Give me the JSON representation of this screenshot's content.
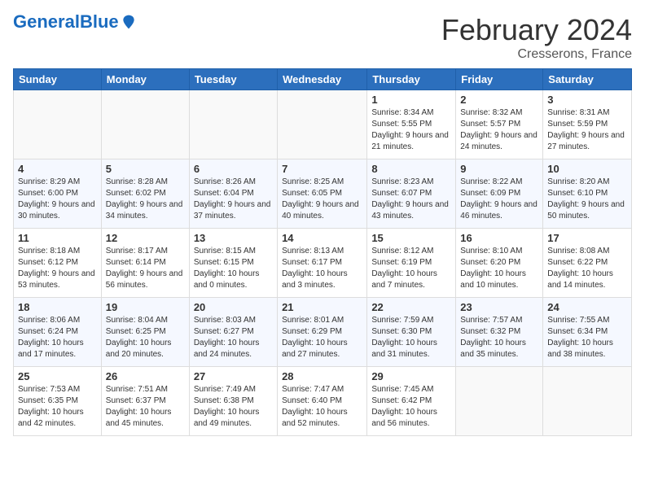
{
  "header": {
    "logo_general": "General",
    "logo_blue": "Blue",
    "month_title": "February 2024",
    "location": "Cresserons, France"
  },
  "days_of_week": [
    "Sunday",
    "Monday",
    "Tuesday",
    "Wednesday",
    "Thursday",
    "Friday",
    "Saturday"
  ],
  "weeks": [
    [
      {
        "day": "",
        "sunrise": "",
        "sunset": "",
        "daylight": ""
      },
      {
        "day": "",
        "sunrise": "",
        "sunset": "",
        "daylight": ""
      },
      {
        "day": "",
        "sunrise": "",
        "sunset": "",
        "daylight": ""
      },
      {
        "day": "",
        "sunrise": "",
        "sunset": "",
        "daylight": ""
      },
      {
        "day": "1",
        "sunrise": "8:34 AM",
        "sunset": "5:55 PM",
        "daylight": "9 hours and 21 minutes."
      },
      {
        "day": "2",
        "sunrise": "8:32 AM",
        "sunset": "5:57 PM",
        "daylight": "9 hours and 24 minutes."
      },
      {
        "day": "3",
        "sunrise": "8:31 AM",
        "sunset": "5:59 PM",
        "daylight": "9 hours and 27 minutes."
      }
    ],
    [
      {
        "day": "4",
        "sunrise": "8:29 AM",
        "sunset": "6:00 PM",
        "daylight": "9 hours and 30 minutes."
      },
      {
        "day": "5",
        "sunrise": "8:28 AM",
        "sunset": "6:02 PM",
        "daylight": "9 hours and 34 minutes."
      },
      {
        "day": "6",
        "sunrise": "8:26 AM",
        "sunset": "6:04 PM",
        "daylight": "9 hours and 37 minutes."
      },
      {
        "day": "7",
        "sunrise": "8:25 AM",
        "sunset": "6:05 PM",
        "daylight": "9 hours and 40 minutes."
      },
      {
        "day": "8",
        "sunrise": "8:23 AM",
        "sunset": "6:07 PM",
        "daylight": "9 hours and 43 minutes."
      },
      {
        "day": "9",
        "sunrise": "8:22 AM",
        "sunset": "6:09 PM",
        "daylight": "9 hours and 46 minutes."
      },
      {
        "day": "10",
        "sunrise": "8:20 AM",
        "sunset": "6:10 PM",
        "daylight": "9 hours and 50 minutes."
      }
    ],
    [
      {
        "day": "11",
        "sunrise": "8:18 AM",
        "sunset": "6:12 PM",
        "daylight": "9 hours and 53 minutes."
      },
      {
        "day": "12",
        "sunrise": "8:17 AM",
        "sunset": "6:14 PM",
        "daylight": "9 hours and 56 minutes."
      },
      {
        "day": "13",
        "sunrise": "8:15 AM",
        "sunset": "6:15 PM",
        "daylight": "10 hours and 0 minutes."
      },
      {
        "day": "14",
        "sunrise": "8:13 AM",
        "sunset": "6:17 PM",
        "daylight": "10 hours and 3 minutes."
      },
      {
        "day": "15",
        "sunrise": "8:12 AM",
        "sunset": "6:19 PM",
        "daylight": "10 hours and 7 minutes."
      },
      {
        "day": "16",
        "sunrise": "8:10 AM",
        "sunset": "6:20 PM",
        "daylight": "10 hours and 10 minutes."
      },
      {
        "day": "17",
        "sunrise": "8:08 AM",
        "sunset": "6:22 PM",
        "daylight": "10 hours and 14 minutes."
      }
    ],
    [
      {
        "day": "18",
        "sunrise": "8:06 AM",
        "sunset": "6:24 PM",
        "daylight": "10 hours and 17 minutes."
      },
      {
        "day": "19",
        "sunrise": "8:04 AM",
        "sunset": "6:25 PM",
        "daylight": "10 hours and 20 minutes."
      },
      {
        "day": "20",
        "sunrise": "8:03 AM",
        "sunset": "6:27 PM",
        "daylight": "10 hours and 24 minutes."
      },
      {
        "day": "21",
        "sunrise": "8:01 AM",
        "sunset": "6:29 PM",
        "daylight": "10 hours and 27 minutes."
      },
      {
        "day": "22",
        "sunrise": "7:59 AM",
        "sunset": "6:30 PM",
        "daylight": "10 hours and 31 minutes."
      },
      {
        "day": "23",
        "sunrise": "7:57 AM",
        "sunset": "6:32 PM",
        "daylight": "10 hours and 35 minutes."
      },
      {
        "day": "24",
        "sunrise": "7:55 AM",
        "sunset": "6:34 PM",
        "daylight": "10 hours and 38 minutes."
      }
    ],
    [
      {
        "day": "25",
        "sunrise": "7:53 AM",
        "sunset": "6:35 PM",
        "daylight": "10 hours and 42 minutes."
      },
      {
        "day": "26",
        "sunrise": "7:51 AM",
        "sunset": "6:37 PM",
        "daylight": "10 hours and 45 minutes."
      },
      {
        "day": "27",
        "sunrise": "7:49 AM",
        "sunset": "6:38 PM",
        "daylight": "10 hours and 49 minutes."
      },
      {
        "day": "28",
        "sunrise": "7:47 AM",
        "sunset": "6:40 PM",
        "daylight": "10 hours and 52 minutes."
      },
      {
        "day": "29",
        "sunrise": "7:45 AM",
        "sunset": "6:42 PM",
        "daylight": "10 hours and 56 minutes."
      },
      {
        "day": "",
        "sunrise": "",
        "sunset": "",
        "daylight": ""
      },
      {
        "day": "",
        "sunrise": "",
        "sunset": "",
        "daylight": ""
      }
    ]
  ]
}
